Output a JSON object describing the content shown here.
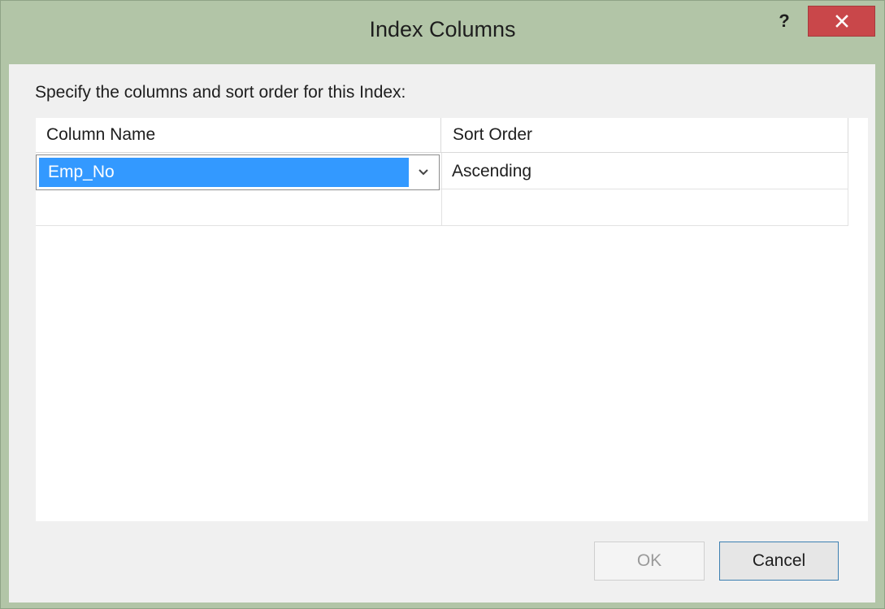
{
  "window": {
    "title": "Index Columns",
    "help_label": "?",
    "close_color": "#c9474a"
  },
  "dialog": {
    "instruction": "Specify the columns and sort order for this Index:"
  },
  "grid": {
    "columns": [
      "Column Name",
      "Sort Order"
    ],
    "rows": [
      {
        "column_name": "Emp_No",
        "sort_order": "Ascending",
        "selected": true
      },
      {
        "column_name": "",
        "sort_order": ""
      }
    ]
  },
  "buttons": {
    "ok_label": "OK",
    "ok_enabled": false,
    "cancel_label": "Cancel"
  },
  "icons": {
    "help": "help-icon",
    "close": "close-icon",
    "dropdown": "chevron-down-icon"
  },
  "colors": {
    "selection": "#3399ff",
    "title_bar": "#b2c5a7",
    "cancel_border": "#3c7fb1"
  }
}
